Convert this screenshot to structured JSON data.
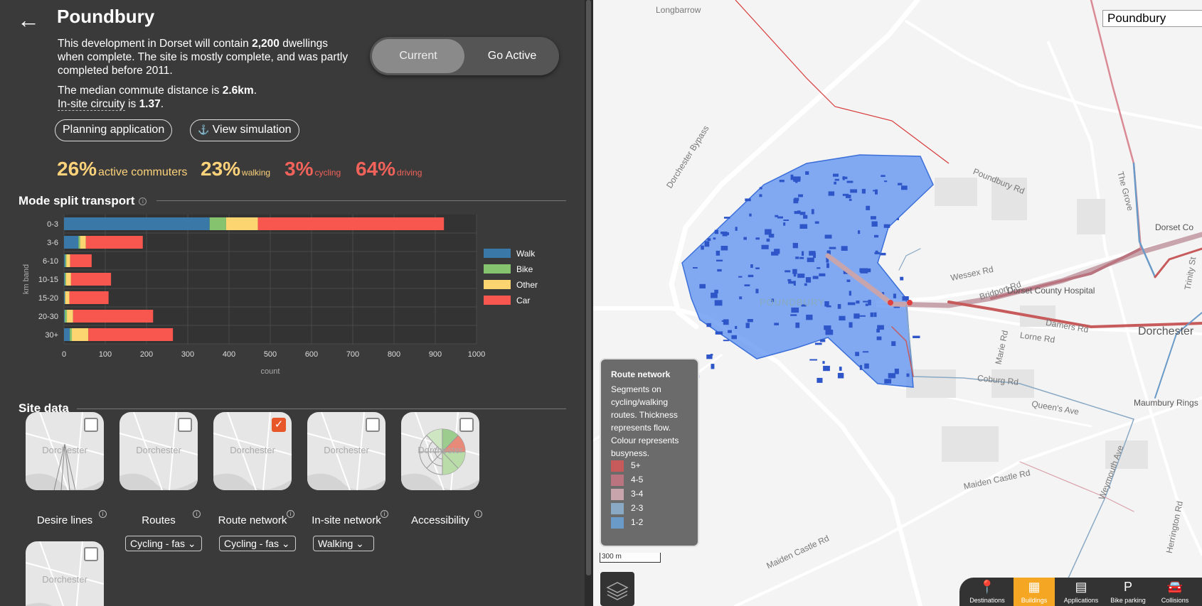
{
  "site": {
    "title": "Poundbury",
    "desc_prefix": "This development in Dorset will contain ",
    "dwellings": "2,200",
    "desc_suffix": " dwellings when complete. The site is mostly complete, and was partly completed before 2011.",
    "commute_prefix": "The median commute distance is ",
    "commute_value": "2.6km",
    "circuity_label": "In-site circuity",
    "circuity_mid": " is ",
    "circuity_value": "1.37"
  },
  "toggle": {
    "current": "Current",
    "go_active": "Go Active"
  },
  "buttons": {
    "planning": "Planning application",
    "simulation": "View simulation"
  },
  "stats": [
    {
      "value": "26%",
      "label": "active commuters",
      "color": "#fcd27a"
    },
    {
      "value": "23%",
      "label": "walking",
      "color": "#fcd27a"
    },
    {
      "value": "3%",
      "label": "cycling",
      "color": "#f0625a"
    },
    {
      "value": "64%",
      "label": "driving",
      "color": "#f0625a"
    }
  ],
  "sections": {
    "mode_split": "Mode split transport",
    "site_data": "Site data"
  },
  "chart_data": {
    "type": "bar",
    "orientation": "horizontal",
    "stacked": true,
    "categories": [
      "0-3",
      "3-6",
      "6-10",
      "10-15",
      "15-20",
      "20-30",
      "30+"
    ],
    "series": [
      {
        "name": "Walk",
        "color": "#3a78a8",
        "values": [
          353,
          35,
          3,
          2,
          2,
          2,
          14
        ]
      },
      {
        "name": "Bike",
        "color": "#86c36f",
        "values": [
          40,
          4,
          3,
          3,
          1,
          5,
          5
        ]
      },
      {
        "name": "Other",
        "color": "#fcd571",
        "values": [
          77,
          14,
          9,
          12,
          10,
          15,
          40
        ]
      },
      {
        "name": "Car",
        "color": "#f8574f",
        "values": [
          451,
          138,
          52,
          97,
          95,
          194,
          205
        ]
      }
    ],
    "xlabel": "count",
    "ylabel": "km band",
    "xlim": [
      0,
      1000
    ],
    "xticks": [
      "0",
      "100",
      "200",
      "300",
      "400",
      "500",
      "600",
      "700",
      "800",
      "900",
      "1000"
    ],
    "grid": true,
    "legend_position": "right"
  },
  "site_cards": [
    {
      "label": "Desire lines",
      "checked": false,
      "thumb": "Dorchester"
    },
    {
      "label": "Routes",
      "checked": false,
      "thumb": "Dorchester",
      "select": "Cycling - fas"
    },
    {
      "label": "Route network",
      "checked": true,
      "thumb": "Dorchester",
      "select": "Cycling - fas"
    },
    {
      "label": "In-site network",
      "checked": false,
      "thumb": "Dorchester",
      "select": "Walking"
    },
    {
      "label": "Accessibility",
      "checked": false,
      "thumb": "Dorchester"
    },
    {
      "label": "",
      "checked": false,
      "thumb": "Dorchester"
    }
  ],
  "map": {
    "search_value": "Poundbury",
    "scale": "300 m",
    "labels": {
      "longbarrow": "Longbarrow",
      "bypass": "Dorchester Bypass",
      "poundbury_rd": "Poundbury Rd",
      "grove": "The Grove",
      "dorset_co": "Dorset Co",
      "wessex": "Wessex Rd",
      "bridport": "Bridport Rd",
      "hospital": "Dorset County Hospital",
      "trinity": "Trinity St",
      "poundbury_area": "POUNDBURY",
      "damers": "Damers Rd",
      "dorchester": "Dorchester",
      "lorne": "Lorne Rd",
      "marie": "Marie Rd",
      "coburg": "Coburg Rd",
      "maumbury": "Maumbury Rings",
      "queens": "Queen's Ave",
      "weymouth": "Weymouth Ave",
      "maiden_castle": "Maiden Castle Rd",
      "maiden_castle2": "Maiden Castle Rd",
      "herrington": "Herrington Rd"
    },
    "legend": {
      "title": "Route network",
      "desc": "Segments on cycling/walking routes. Thickness represents flow. Colour represents busyness.",
      "items": [
        {
          "label": "5+",
          "color": "#c75b5b"
        },
        {
          "label": "4-5",
          "color": "#b9747f"
        },
        {
          "label": "3-4",
          "color": "#c8a4ad"
        },
        {
          "label": "2-3",
          "color": "#8aa9c4"
        },
        {
          "label": "1-2",
          "color": "#6a9ac7"
        }
      ]
    },
    "nav": [
      {
        "label": "Destinations",
        "icon": "map-pin-icon",
        "glyph": "📍",
        "active": false
      },
      {
        "label": "Buildings",
        "icon": "building-icon",
        "glyph": "▦",
        "active": true
      },
      {
        "label": "Applications",
        "icon": "document-icon",
        "glyph": "▤",
        "active": false
      },
      {
        "label": "Bike parking",
        "icon": "parking-icon",
        "glyph": "P",
        "active": false
      },
      {
        "label": "Collisions",
        "icon": "car-crash-icon",
        "glyph": "🚘",
        "active": false
      }
    ]
  }
}
